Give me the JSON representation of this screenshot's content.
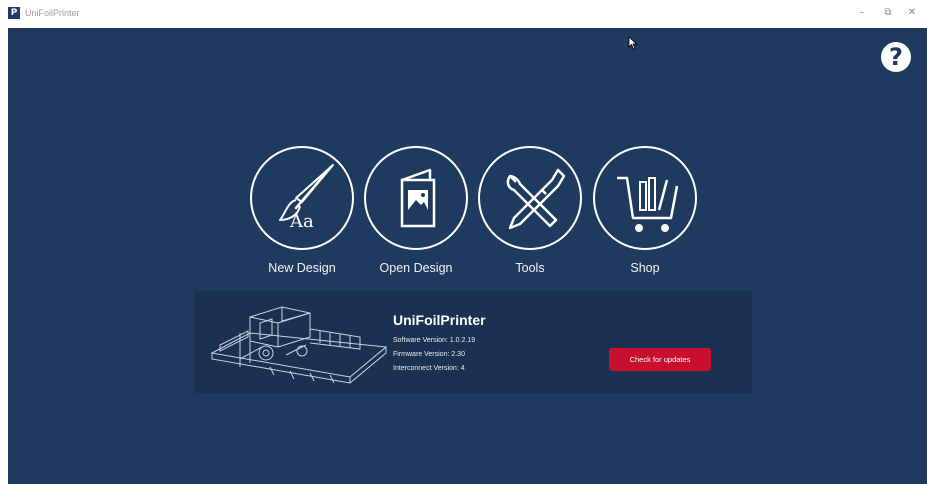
{
  "window": {
    "title": "UniFoilPrinter",
    "app_icon_letter": "P",
    "minimize_glyph": "–",
    "restore_glyph": "⧉",
    "close_glyph": "✕"
  },
  "help": {
    "glyph": "?",
    "icon": "help-question-icon"
  },
  "tiles": [
    {
      "label": "New Design",
      "icon": "brush-text-icon"
    },
    {
      "label": "Open Design",
      "icon": "open-file-image-icon"
    },
    {
      "label": "Tools",
      "icon": "wrench-screwdriver-icon"
    },
    {
      "label": "Shop",
      "icon": "shopping-cart-icon"
    }
  ],
  "product": {
    "name": "UniFoilPrinter",
    "software_version": "Software Version: 1.0.2.19",
    "firmware_version": "Firmware Version: 2.30",
    "interconnect_version": "Interconnect Version: 4",
    "update_button": "Check for updates"
  },
  "colors": {
    "background": "#1f3a5f",
    "panel": "#1b3152",
    "accent": "#c8102e",
    "foreground": "#ffffff"
  }
}
